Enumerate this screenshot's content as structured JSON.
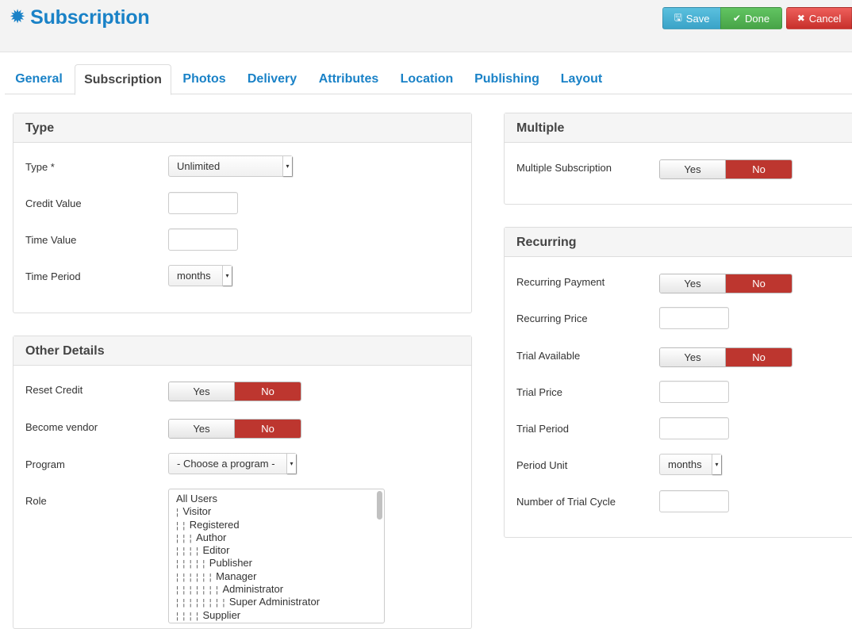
{
  "header": {
    "title": "Subscription",
    "buttons": {
      "save": "Save",
      "done": "Done",
      "cancel": "Cancel"
    }
  },
  "tabs": [
    "General",
    "Subscription",
    "Photos",
    "Delivery",
    "Attributes",
    "Location",
    "Publishing",
    "Layout"
  ],
  "type_panel": {
    "title": "Type",
    "type_label": "Type *",
    "type_value": "Unlimited",
    "credit_label": "Credit Value",
    "time_value_label": "Time Value",
    "time_period_label": "Time Period",
    "time_period_value": "months"
  },
  "other_panel": {
    "title": "Other Details",
    "reset_credit_label": "Reset Credit",
    "become_vendor_label": "Become vendor",
    "program_label": "Program",
    "program_value": "- Choose a program -",
    "role_label": "Role",
    "roles": [
      {
        "depth": 0,
        "name": "All Users"
      },
      {
        "depth": 1,
        "name": "Visitor"
      },
      {
        "depth": 2,
        "name": "Registered"
      },
      {
        "depth": 3,
        "name": "Author"
      },
      {
        "depth": 4,
        "name": "Editor"
      },
      {
        "depth": 5,
        "name": "Publisher"
      },
      {
        "depth": 6,
        "name": "Manager"
      },
      {
        "depth": 7,
        "name": "Administrator"
      },
      {
        "depth": 8,
        "name": "Super Administrator"
      },
      {
        "depth": 4,
        "name": "Supplier"
      }
    ]
  },
  "multiple_panel": {
    "title": "Multiple",
    "multiple_label": "Multiple Subscription"
  },
  "recurring_panel": {
    "title": "Recurring",
    "recurring_payment_label": "Recurring Payment",
    "recurring_price_label": "Recurring Price",
    "trial_available_label": "Trial Available",
    "trial_price_label": "Trial Price",
    "trial_period_label": "Trial Period",
    "period_unit_label": "Period Unit",
    "period_unit_value": "months",
    "trial_cycle_label": "Number of Trial Cycle"
  },
  "toggle": {
    "yes": "Yes",
    "no": "No"
  },
  "colors": {
    "brand": "#1a82c7",
    "no_active": "#bd362f"
  }
}
